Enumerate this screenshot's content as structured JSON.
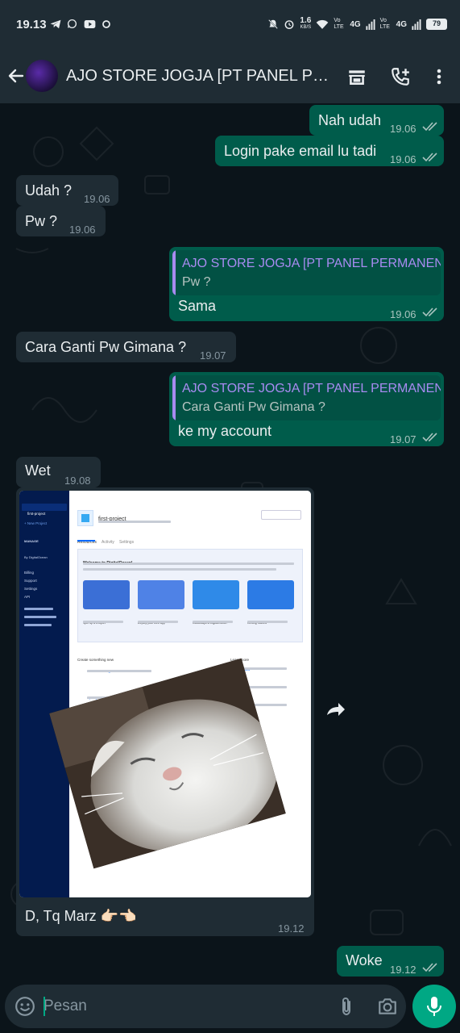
{
  "status_bar": {
    "time": "19.13",
    "notif_icons": [
      "telegram-icon",
      "whatsapp-icon",
      "youtube-icon",
      "circle-icon"
    ],
    "net_speed": "1.6",
    "net_unit": "KB/S",
    "sim1": "Vo LTE",
    "sim_sig": "4G",
    "sim2": "Vo LTE",
    "battery": "79"
  },
  "header": {
    "title": "AJO STORE JOGJA [PT PANEL PERMANEN]"
  },
  "messages": [
    {
      "id": "m1",
      "dir": "out",
      "text": "Nah udah",
      "time": "19.06"
    },
    {
      "id": "m2",
      "dir": "out",
      "text": "Login pake email lu tadi",
      "time": "19.06"
    },
    {
      "id": "m3",
      "dir": "in",
      "text": "Udah ?",
      "time": "19.06"
    },
    {
      "id": "m4",
      "dir": "in",
      "text": "Pw ?",
      "time": "19.06"
    },
    {
      "id": "m5",
      "dir": "out",
      "quote_name": "AJO STORE JOGJA [PT PANEL PERMANEN]",
      "quote_text": "Pw ?",
      "text": "Sama",
      "time": "19.06"
    },
    {
      "id": "m6",
      "dir": "in",
      "text": "Cara Ganti Pw Gimana ?",
      "time": "19.07"
    },
    {
      "id": "m7",
      "dir": "out",
      "quote_name": "AJO STORE JOGJA [PT PANEL PERMANEN]",
      "quote_text": "Cara Ganti Pw Gimana ?",
      "text": "ke my account",
      "time": "19.07"
    },
    {
      "id": "m8",
      "dir": "in",
      "text": "Wet",
      "time": "19.08"
    },
    {
      "id": "m9",
      "dir": "in",
      "type": "image",
      "caption": "D, Tq Marz 👉🏻👈🏻",
      "time": "19.12"
    },
    {
      "id": "m10",
      "dir": "out",
      "text": "Woke",
      "time": "19.12"
    }
  ],
  "screenshot": {
    "sidebar": {
      "projects": "PROJECTS",
      "first_project": "first-project",
      "new_project": "+ New Project",
      "manage": "MANAGE",
      "by": "By DigitalOcean",
      "billing": "Billing",
      "support": "Support",
      "settings": "Settings",
      "api": "API"
    },
    "title": "first-project",
    "tabs": [
      "Resources",
      "Activity",
      "Settings"
    ],
    "welcome_title": "Welcome to DigitalOcean!",
    "cards": [
      {
        "title": "Spin up a Droplet",
        "color": "#3b6fd6"
      },
      {
        "title": "Deploy your web app",
        "color": "#4f82e6"
      },
      {
        "title": "Cloudways & DigitalOcean",
        "color": "#2f8ae8"
      },
      {
        "title": "Getting Started",
        "color": "#2c7be5"
      }
    ],
    "create_title": "Create something new",
    "learn_title": "Learn more",
    "create_items": [
      "Create a Managed Database",
      "Spin up a Load Balancer"
    ],
    "learn_items": [
      "Product Docs",
      "Tutorial",
      "API & CLI Docs",
      "Ask a question"
    ]
  },
  "input": {
    "placeholder": "Pesan"
  },
  "colors": {
    "header_bg": "#1f2c34",
    "chat_bg": "#0b141a",
    "outgoing_bubble": "#005c4b",
    "incoming_bubble": "#1f2c34",
    "accent": "#00a884",
    "quote_name": "#a88bf1",
    "read_ticks": "#a9c4bf"
  }
}
